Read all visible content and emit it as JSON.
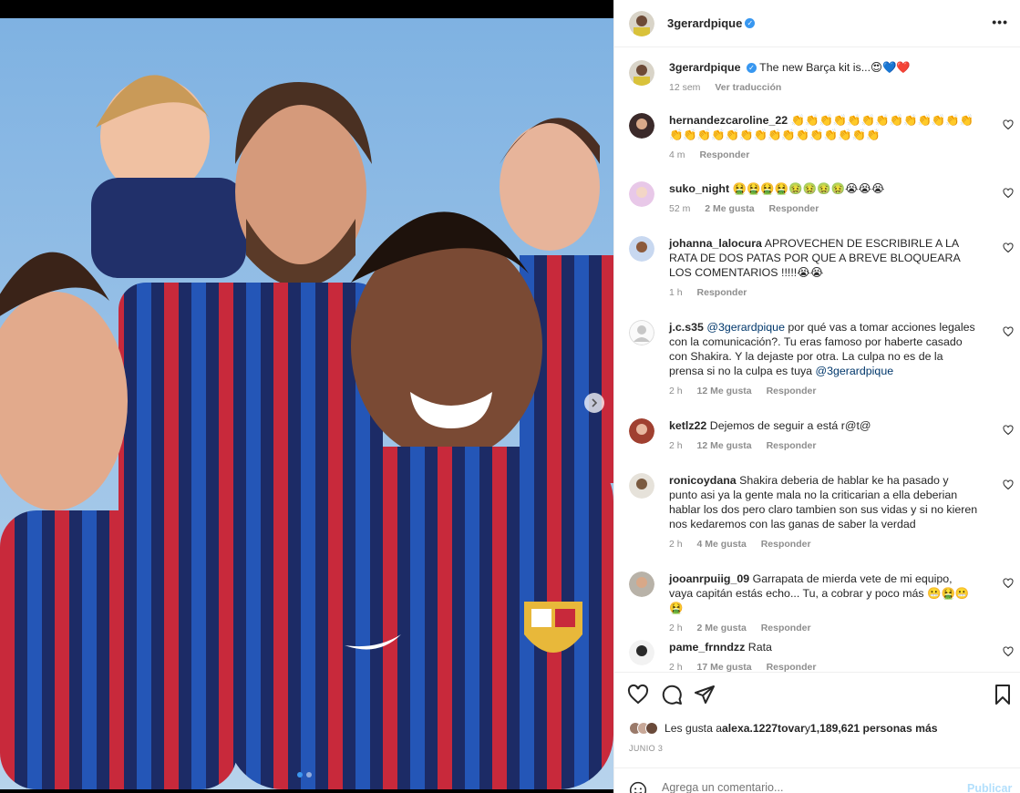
{
  "post": {
    "username": "3gerardpique",
    "more_icon": "more-horizontal-icon"
  },
  "caption": {
    "username": "3gerardpique",
    "text": "The new Barça kit is...😍💙❤️",
    "time": "12 sem",
    "translate": "Ver traducción"
  },
  "comments": [
    {
      "username": "hernandezcaroline_22",
      "text": "👏👏👏👏👏👏👏👏👏👏👏👏👏👏👏👏👏👏👏👏👏👏👏👏👏👏👏👏",
      "time": "4 m",
      "likes": "",
      "reply": "Responder"
    },
    {
      "username": "suko_night",
      "text": "🤮🤮🤮🤮🤢🤢🤢🤢😭😭😭",
      "time": "52 m",
      "likes": "2 Me gusta",
      "reply": "Responder"
    },
    {
      "username": "johanna_lalocura",
      "text": "APROVECHEN DE ESCRIBIRLE A LA RATA DE DOS PATAS POR QUE A BREVE BLOQUEARA LOS COMENTARIOS !!!!!😭😭",
      "time": "1 h",
      "likes": "",
      "reply": "Responder"
    },
    {
      "username": "j.c.s35",
      "mention": "@3gerardpique",
      "text": " por qué vas a tomar acciones legales con la comunicación?. Tu eras famoso por haberte casado con Shakira. Y la dejaste por otra. La culpa no es de la prensa si no la culpa es tuya ",
      "mention2": "@3gerardpique",
      "time": "2 h",
      "likes": "12 Me gusta",
      "reply": "Responder"
    },
    {
      "username": "ketlz22",
      "text": "Dejemos de seguir a está r@t@",
      "time": "2 h",
      "likes": "12 Me gusta",
      "reply": "Responder"
    },
    {
      "username": "ronicoydana",
      "text": "Shakira deberia de hablar ke ha pasado y punto asi ya la gente mala no la criticarian a ella deberian hablar los dos pero claro tambien son sus vidas y si no kieren nos kedaremos con las ganas de saber la verdad",
      "time": "2 h",
      "likes": "4 Me gusta",
      "reply": "Responder"
    },
    {
      "username": "jooanrpuiig_09",
      "text": "Garrapata de mierda vete de mi equipo, vaya capitán estás echo... Tu, a cobrar y poco más 😬🤮😬🤮",
      "time": "2 h",
      "likes": "2 Me gusta",
      "reply": "Responder"
    },
    {
      "username": "pame_frnndzz",
      "text": "Rata",
      "time": "2 h",
      "likes": "17 Me gusta",
      "reply": "Responder"
    }
  ],
  "likes": {
    "prefix": "Les gusta a ",
    "user": "alexa.1227tovar",
    "mid": " y ",
    "count": "1,189,621 personas más"
  },
  "date": "JUNIO 3",
  "add_comment": {
    "placeholder": "Agrega un comentario...",
    "publish": "Publicar"
  },
  "colors": {
    "accent": "#0095f6",
    "link": "#00376b",
    "muted": "#8e8e8e",
    "verified": "#3897f0"
  }
}
